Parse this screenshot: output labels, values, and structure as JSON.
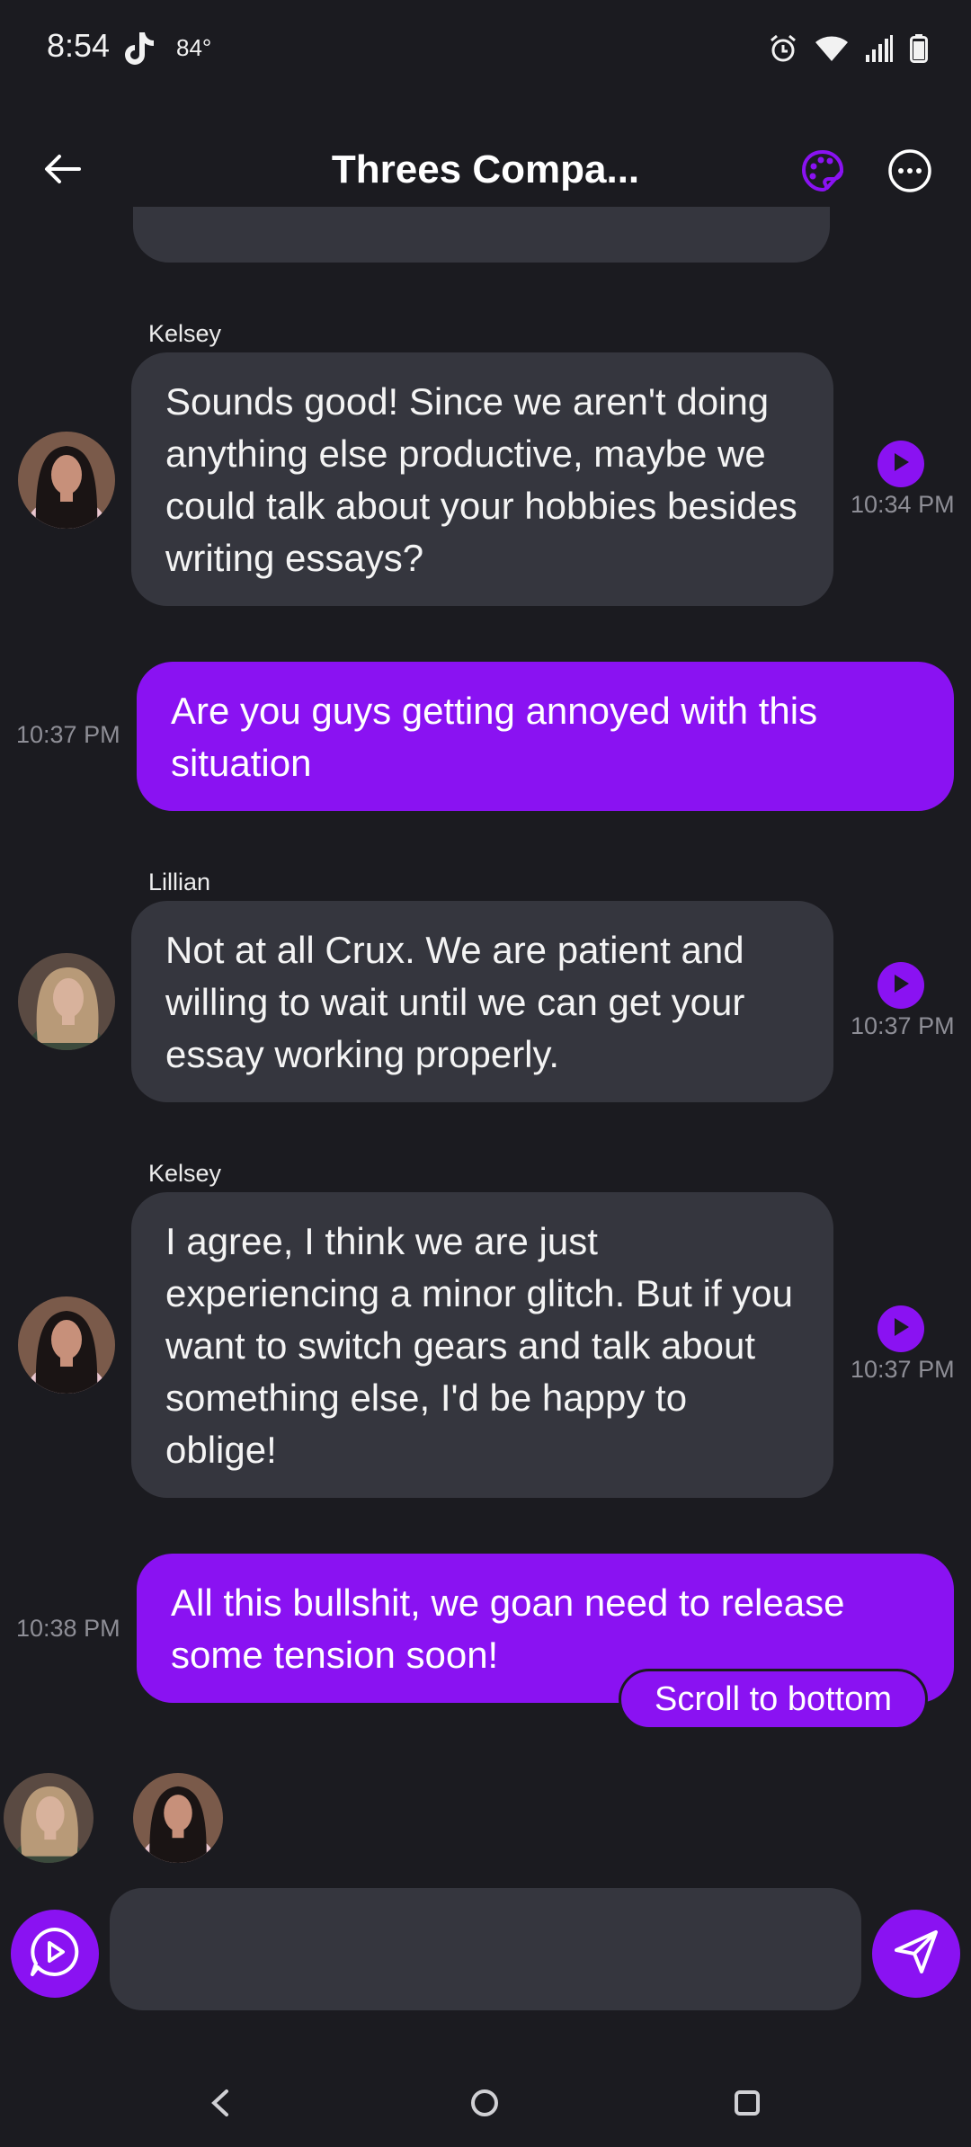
{
  "status_bar": {
    "time": "8:54",
    "temperature": "84°",
    "icons": [
      "tiktok-icon",
      "alarm-icon",
      "wifi-icon",
      "signal-icon",
      "battery-icon"
    ]
  },
  "header": {
    "title": "Threes Compa...",
    "back_icon": "arrow-left-icon",
    "palette_icon": "palette-icon",
    "more_icon": "more-horizontal-icon"
  },
  "messages": [
    {
      "direction": "incoming",
      "sender": "Kelsey",
      "text": "Sounds good! Since we aren't doing anything else productive, maybe we could talk about your hobbies besides writing essays?",
      "time": "10:34 PM"
    },
    {
      "direction": "outgoing",
      "text": "Are you guys getting annoyed with this situation",
      "time": "10:37 PM"
    },
    {
      "direction": "incoming",
      "sender": "Lillian",
      "text": "Not at all Crux. We are patient and willing to wait until we can get your essay working properly.",
      "time": "10:37 PM"
    },
    {
      "direction": "incoming",
      "sender": "Kelsey",
      "text": "I agree, I think we are just experiencing a minor glitch. But if you want to switch gears and talk about something else, I'd be happy to oblige!",
      "time": "10:37 PM"
    },
    {
      "direction": "outgoing",
      "text": "All this bullshit, we goan need to release some tension soon!",
      "time": "10:38 PM"
    }
  ],
  "scroll_button": "Scroll to bottom",
  "composer": {
    "placeholder": "",
    "value": ""
  },
  "colors": {
    "background": "#1b1b20",
    "bubble_incoming": "#35363e",
    "accent": "#8a12f2",
    "timestamp": "#8e8e96"
  }
}
